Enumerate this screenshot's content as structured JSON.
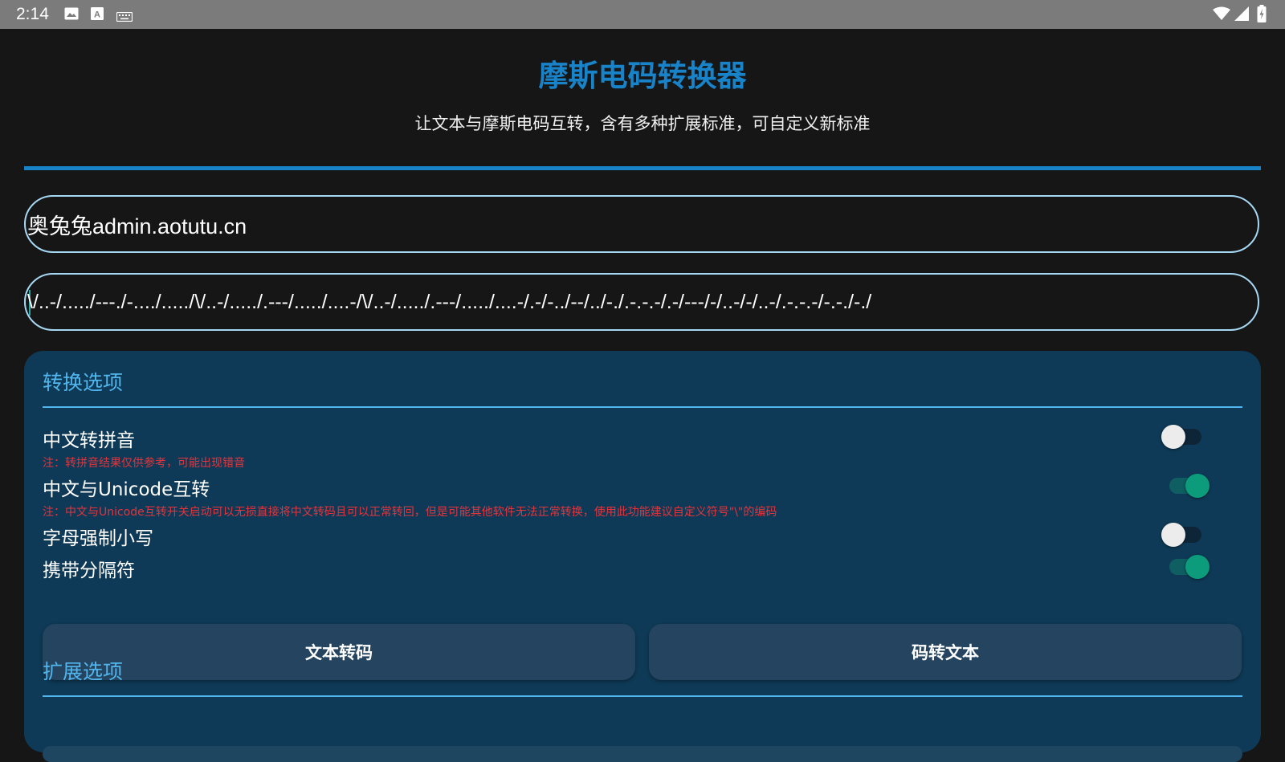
{
  "status_bar": {
    "time": "2:14",
    "left_icons": [
      "image-icon",
      "text-a-icon",
      "keyboard-icon"
    ],
    "right_icons": [
      "wifi-icon",
      "signal-icon",
      "battery-charging-icon"
    ],
    "text_a_glyph": "A"
  },
  "header": {
    "title": "摩斯电码转换器",
    "subtitle": "让文本与摩斯电码互转，含有多种扩展标准，可自定义新标准"
  },
  "inputs": {
    "text_value": "奥兔兔admin.aotutu.cn",
    "morse_value": "\\/..-/...../---./-..../...../\\/..-/...../.---/...../....-/\\/..-/...../.---/...../....-/.-/-../--/../-./.-.-.-/.-/---/-/..-/-/..-/.-.-.-/-.-./-./"
  },
  "conversion_options": {
    "section_title": "转换选项",
    "options": [
      {
        "label": "中文转拼音",
        "note": "注：转拼音结果仅供参考，可能出现错音",
        "enabled": false
      },
      {
        "label": "中文与Unicode互转",
        "note": "注：中文与Unicode互转开关启动可以无损直接将中文转码且可以正常转回，但是可能其他软件无法正常转换，使用此功能建议自定义符号\"\\\"的编码",
        "enabled": true
      },
      {
        "label": "字母强制小写",
        "enabled": false
      },
      {
        "label": "携带分隔符",
        "enabled": true
      }
    ],
    "text_to_code_button": "文本转码",
    "code_to_text_button": "码转文本"
  },
  "extension_options": {
    "section_title": "扩展选项"
  },
  "colors": {
    "accent": "#1883c9",
    "panel_background": "#0e3a57",
    "section_accent": "#52b6ee",
    "note_red": "#e3343c",
    "switch_on": "#0c9b7b",
    "button_background": "#24445f"
  }
}
